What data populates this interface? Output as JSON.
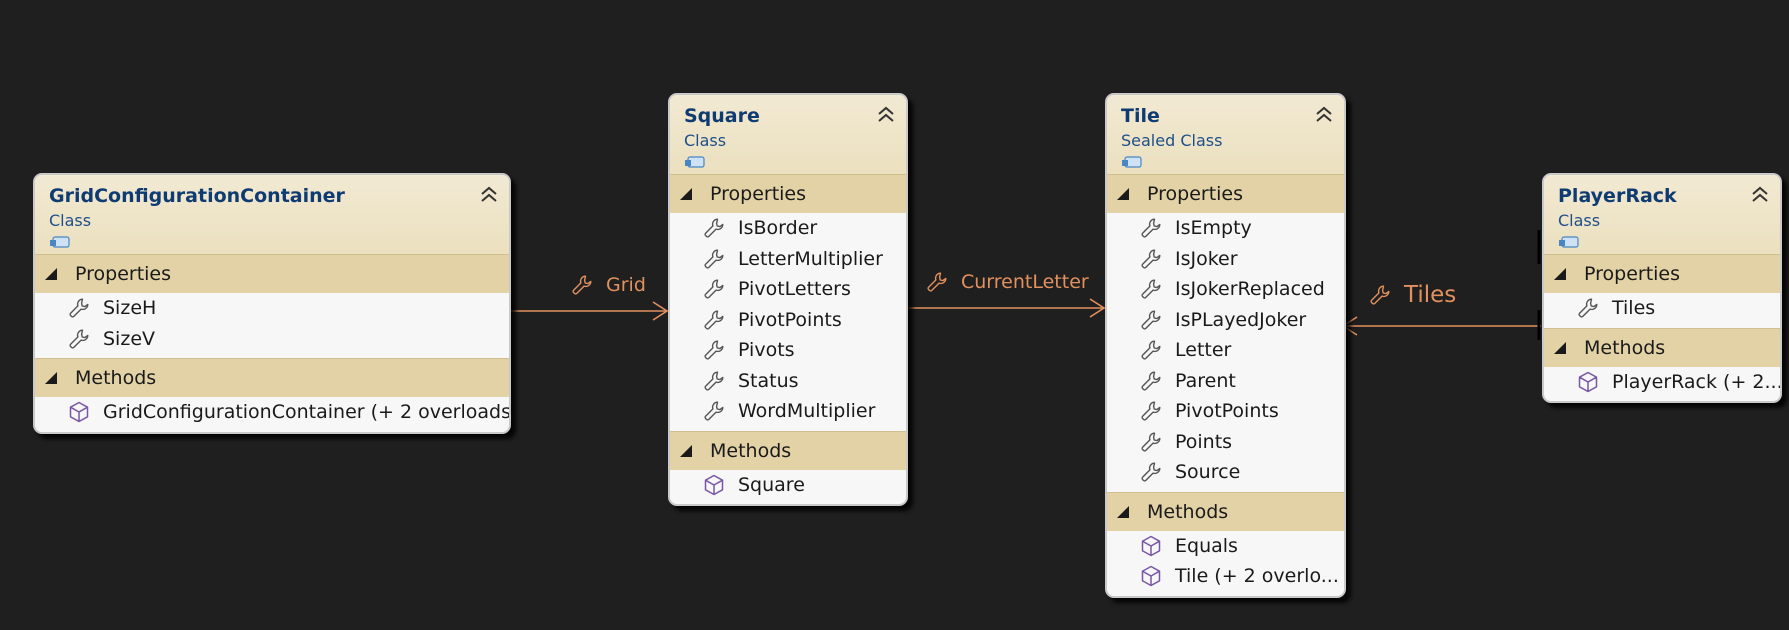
{
  "colors": {
    "background": "#1f1f1f",
    "connector": "#e2915e",
    "class_name": "#0f3b73",
    "header": "#ebe0bf",
    "section": "#e2d2a6"
  },
  "icons": {
    "property": "wrench-icon",
    "method": "cube-icon",
    "collapse": "chevron-double-up-icon",
    "class_badge": "class-badge-icon"
  },
  "classes": [
    {
      "name": "GridConfigurationContainer",
      "kind": "Class",
      "sections": [
        {
          "title": "Properties",
          "kind": "property",
          "items": [
            "SizeH",
            "SizeV"
          ]
        },
        {
          "title": "Methods",
          "kind": "method",
          "items": [
            "GridConfigurationContainer (+ 2 overloads)"
          ]
        }
      ]
    },
    {
      "name": "Square",
      "kind": "Class",
      "sections": [
        {
          "title": "Properties",
          "kind": "property",
          "items": [
            "IsBorder",
            "LetterMultiplier",
            "PivotLetters",
            "PivotPoints",
            "Pivots",
            "Status",
            "WordMultiplier"
          ]
        },
        {
          "title": "Methods",
          "kind": "method",
          "items": [
            "Square"
          ]
        }
      ]
    },
    {
      "name": "Tile",
      "kind": "Sealed Class",
      "sections": [
        {
          "title": "Properties",
          "kind": "property",
          "items": [
            "IsEmpty",
            "IsJoker",
            "IsJokerReplaced",
            "IsPLayedJoker",
            "Letter",
            "Parent",
            "PivotPoints",
            "Points",
            "Source"
          ]
        },
        {
          "title": "Methods",
          "kind": "method",
          "items": [
            "Equals",
            "Tile (+ 2 overlo..."
          ]
        }
      ]
    },
    {
      "name": "PlayerRack",
      "kind": "Class",
      "sections": [
        {
          "title": "Properties",
          "kind": "property",
          "items": [
            "Tiles"
          ]
        },
        {
          "title": "Methods",
          "kind": "method",
          "items": [
            "PlayerRack (+ 2..."
          ]
        }
      ]
    }
  ],
  "associations": [
    {
      "label": "Grid",
      "from": "GridConfigurationContainer",
      "to": "Square"
    },
    {
      "label": "CurrentLetter",
      "from": "Square",
      "to": "Tile"
    },
    {
      "label": "Tiles",
      "from": "PlayerRack",
      "to": "Tile"
    }
  ]
}
